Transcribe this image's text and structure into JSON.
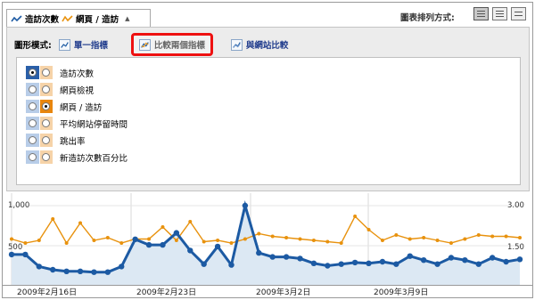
{
  "tabs": {
    "series_a": "造訪次數",
    "separator": "/",
    "series_b": "網頁 / 造訪",
    "dropdown_arrow": "▲"
  },
  "sort": {
    "label": "圖表排列方式:"
  },
  "view_buttons": [
    "chart-view-icon",
    "table-view-icon",
    "list-view-icon"
  ],
  "mode": {
    "label": "圖形模式:",
    "options": [
      {
        "label": "單一指標",
        "icon": "single-metric-chart-icon"
      },
      {
        "label": "比較兩個指標",
        "icon": "compare-two-metrics-chart-icon"
      },
      {
        "label": "與網站比較",
        "icon": "compare-site-chart-icon"
      }
    ]
  },
  "metrics": [
    {
      "label": "造訪次數",
      "blue_selected": true,
      "orange_selected": false
    },
    {
      "label": "網頁檢視",
      "blue_selected": false,
      "orange_selected": false
    },
    {
      "label": "網頁 / 造訪",
      "blue_selected": false,
      "orange_selected": true
    },
    {
      "label": "平均網站停留時間",
      "blue_selected": false,
      "orange_selected": false
    },
    {
      "label": "跳出率",
      "blue_selected": false,
      "orange_selected": false
    },
    {
      "label": "新造訪次數百分比",
      "blue_selected": false,
      "orange_selected": false
    }
  ],
  "chart_data": {
    "type": "line",
    "left_axis": {
      "ticks": [
        "1,000",
        "500"
      ],
      "ylim": [
        0,
        1000
      ]
    },
    "right_axis": {
      "ticks": [
        "3.00",
        "1.50"
      ],
      "ylim": [
        0,
        3
      ]
    },
    "x_labels": [
      "2009年2月16日",
      "2009年2月23日",
      "2009年3月2日",
      "2009年3月9日"
    ],
    "colors": {
      "blue": "#1c5aa3",
      "orange": "#e8920e",
      "area": "#dce8f3"
    },
    "series": [
      {
        "axis": "left",
        "values": [
          390,
          390,
          240,
          200,
          180,
          180,
          170,
          170,
          240,
          580,
          510,
          510,
          660,
          440,
          270,
          490,
          260,
          1000,
          410,
          360,
          360,
          340,
          280,
          250,
          270,
          290,
          280,
          300,
          270,
          370,
          320,
          270,
          350,
          320,
          270,
          350,
          300,
          330
        ]
      },
      {
        "axis": "right",
        "values": [
          1.75,
          1.6,
          1.7,
          2.5,
          1.6,
          2.35,
          1.7,
          1.8,
          1.6,
          1.75,
          1.75,
          2.2,
          1.7,
          2.4,
          1.65,
          1.7,
          1.6,
          1.75,
          1.95,
          1.85,
          1.8,
          1.75,
          1.7,
          1.65,
          1.6,
          2.6,
          2.1,
          1.7,
          1.9,
          1.75,
          1.8,
          1.7,
          1.6,
          1.75,
          1.9,
          1.85,
          1.85,
          1.8
        ]
      }
    ]
  }
}
